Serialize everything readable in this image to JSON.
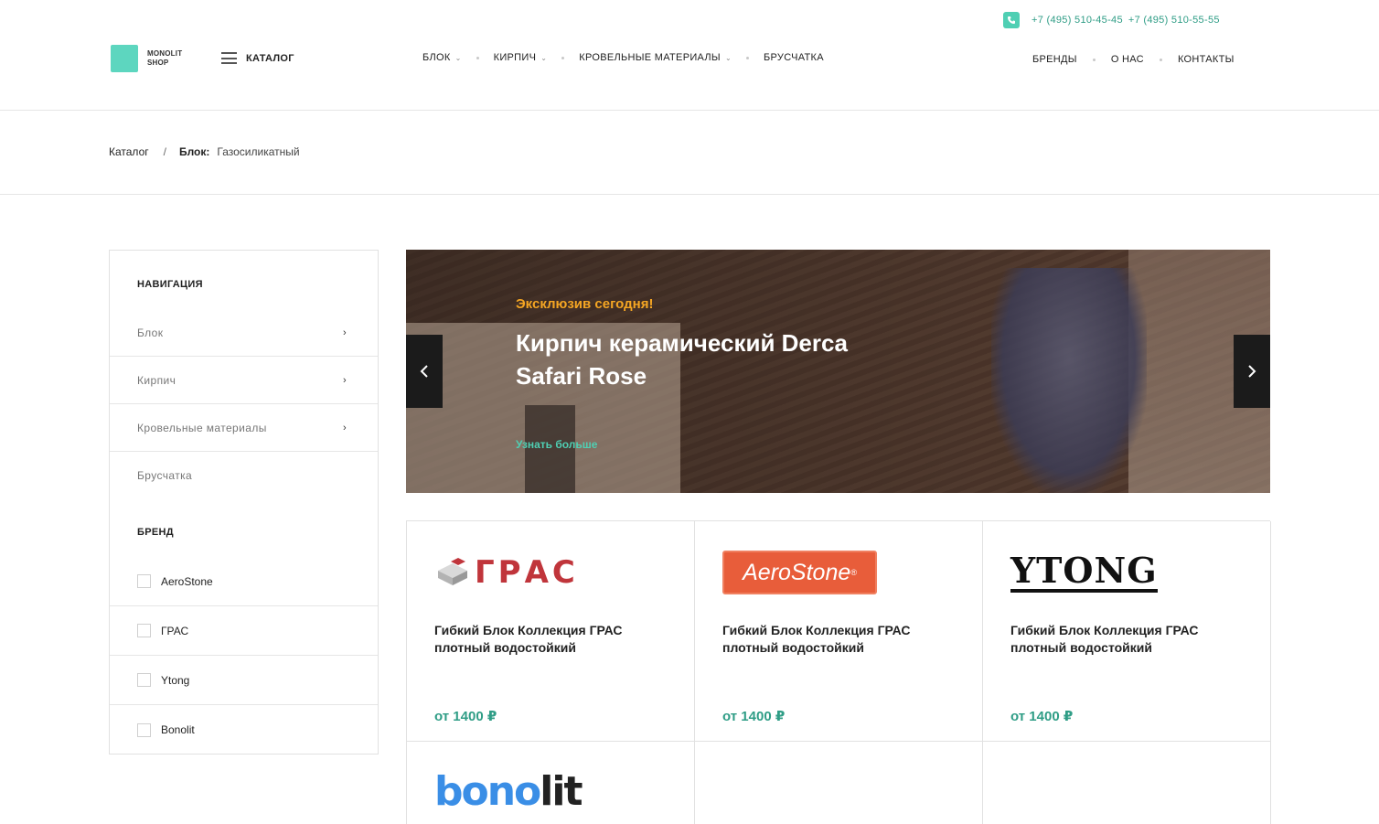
{
  "header": {
    "logo_text_line1": "MONOLIT",
    "logo_text_line2": "SHOP",
    "catalog_label": "КАТАЛОГ",
    "nav": [
      {
        "label": "БЛОК",
        "has_dropdown": true
      },
      {
        "label": "КИРПИЧ",
        "has_dropdown": true
      },
      {
        "label": "КРОВЕЛЬНЫЕ МАТЕРИАЛЫ",
        "has_dropdown": true
      },
      {
        "label": "БРУСЧАТКА",
        "has_dropdown": false
      }
    ],
    "phones": [
      "+7 (495) 510-45-45",
      "+7 (495) 510-55-55"
    ],
    "right_nav": [
      {
        "label": "БРЕНДЫ"
      },
      {
        "label": "О НАС"
      },
      {
        "label": "КОНТАКТЫ"
      }
    ],
    "chevron": "⌄",
    "accent_color": "#4fcfb3"
  },
  "breadcrumb": {
    "root": "Каталог",
    "separator": "/",
    "section": "Блок:",
    "current": "Газосиликатный"
  },
  "sidebar": {
    "nav_heading": "НАВИГАЦИЯ",
    "nav_items": [
      {
        "label": "Блок",
        "has_children": true
      },
      {
        "label": "Кирпич",
        "has_children": true
      },
      {
        "label": "Кровельные материалы",
        "has_children": true
      },
      {
        "label": "Брусчатка",
        "has_children": false
      }
    ],
    "arrow": "›",
    "brand_heading": "БРЕНД",
    "brands": [
      {
        "label": "AeroStone",
        "checked": false
      },
      {
        "label": "ГРАС",
        "checked": false
      },
      {
        "label": "Ytong",
        "checked": false
      },
      {
        "label": "Bonolit",
        "checked": false
      }
    ]
  },
  "slider": {
    "kicker": "Эксклюзив сегодня!",
    "title": "Кирпич керамический Derca Safari Rose",
    "link": "Узнать больше",
    "prev_arrow": "‹",
    "next_arrow": "›",
    "kicker_color": "#f5a623"
  },
  "products": [
    {
      "brand_logo": "ГРАС",
      "name": "Гибкий Блок Коллекция ГРАС плотный водостойкий",
      "price": "от 1400 ₽"
    },
    {
      "brand_logo": "AeroStone",
      "name": "Гибкий Блок Коллекция ГРАС плотный водостойкий",
      "price": "от 1400 ₽"
    },
    {
      "brand_logo": "YTONG",
      "name": "Гибкий Блок Коллекция ГРАС плотный водостойкий",
      "price": "от 1400 ₽"
    },
    {
      "brand_logo": "bonolit"
    }
  ],
  "logo_parts": {
    "aero_mark": "®",
    "bonolit_blue": "bono",
    "bonolit_dark": "lit"
  }
}
